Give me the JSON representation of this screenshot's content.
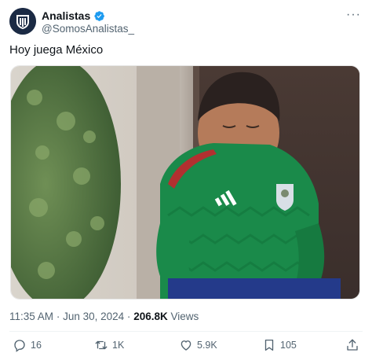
{
  "author": {
    "display_name": "Analistas",
    "handle": "@SomosAnalistas_",
    "verified_icon": "verified-badge-icon",
    "avatar_icon": "club-crest-avatar"
  },
  "tweet": {
    "text": "Hoy juega México"
  },
  "media": {
    "description_icon": "photo-boy-in-mexico-jersey"
  },
  "meta": {
    "time": "11:35 AM",
    "separator": "·",
    "date": "Jun 30, 2024",
    "separator2": "·",
    "views_count": "206.8K",
    "views_label": "Views"
  },
  "actions": {
    "replies": "16",
    "reposts": "1K",
    "likes": "5.9K",
    "bookmarks": "105"
  },
  "colors": {
    "text": "#0f1419",
    "muted": "#536471",
    "verified": "#1d9bf0",
    "jersey": "#1a8a4a"
  }
}
